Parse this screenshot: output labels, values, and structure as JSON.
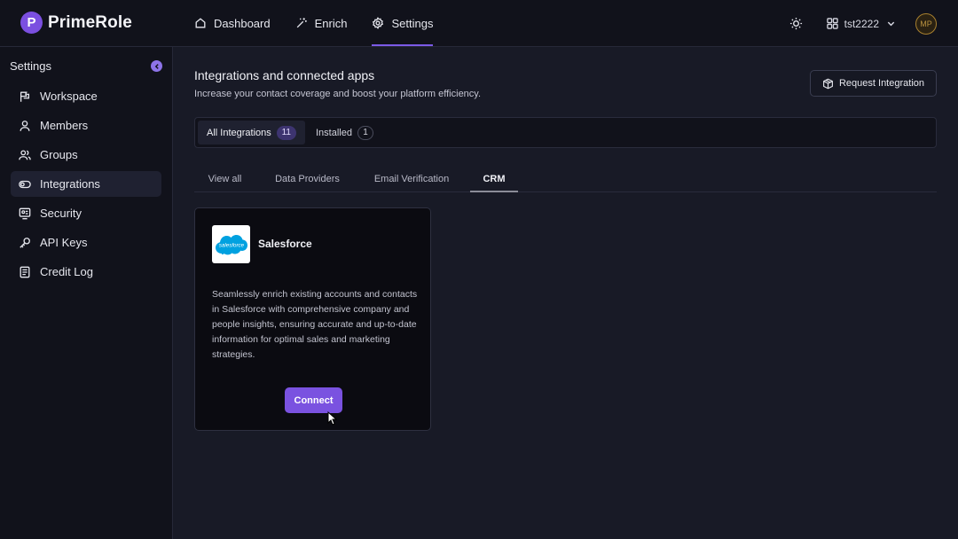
{
  "app": {
    "name": "PrimeRole",
    "logo_letter": "P"
  },
  "nav": [
    {
      "label": "Dashboard",
      "icon": "home-icon"
    },
    {
      "label": "Enrich",
      "icon": "wand-icon"
    },
    {
      "label": "Settings",
      "icon": "gear-icon",
      "active": true
    }
  ],
  "top_right": {
    "workspace": "tst2222",
    "avatar_initials": "MP"
  },
  "sidebar": {
    "title": "Settings",
    "items": [
      {
        "label": "Workspace",
        "icon": "flag-icon"
      },
      {
        "label": "Members",
        "icon": "user-icon"
      },
      {
        "label": "Groups",
        "icon": "users-icon"
      },
      {
        "label": "Integrations",
        "icon": "toggle-icon",
        "active": true
      },
      {
        "label": "Security",
        "icon": "shield-icon"
      },
      {
        "label": "API Keys",
        "icon": "key-icon"
      },
      {
        "label": "Credit Log",
        "icon": "document-icon"
      }
    ]
  },
  "main": {
    "title": "Integrations and connected apps",
    "subtitle": "Increase your contact coverage and boost your platform efficiency.",
    "request_button": "Request Integration",
    "segments": [
      {
        "label": "All Integrations",
        "count": "11",
        "active": true
      },
      {
        "label": "Installed",
        "count": "1"
      }
    ],
    "tabs": [
      {
        "label": "View all"
      },
      {
        "label": "Data Providers"
      },
      {
        "label": "Email Verification"
      },
      {
        "label": "CRM",
        "active": true
      }
    ],
    "card": {
      "name": "Salesforce",
      "logo_text": "salesforce",
      "description": "Seamlessly enrich existing accounts and contacts in Salesforce with comprehensive company and people insights, ensuring accurate and up-to-date information for optimal sales and marketing strategies.",
      "button": "Connect"
    }
  },
  "colors": {
    "accent": "#7a52e0",
    "salesforce_blue": "#00a1e0"
  }
}
